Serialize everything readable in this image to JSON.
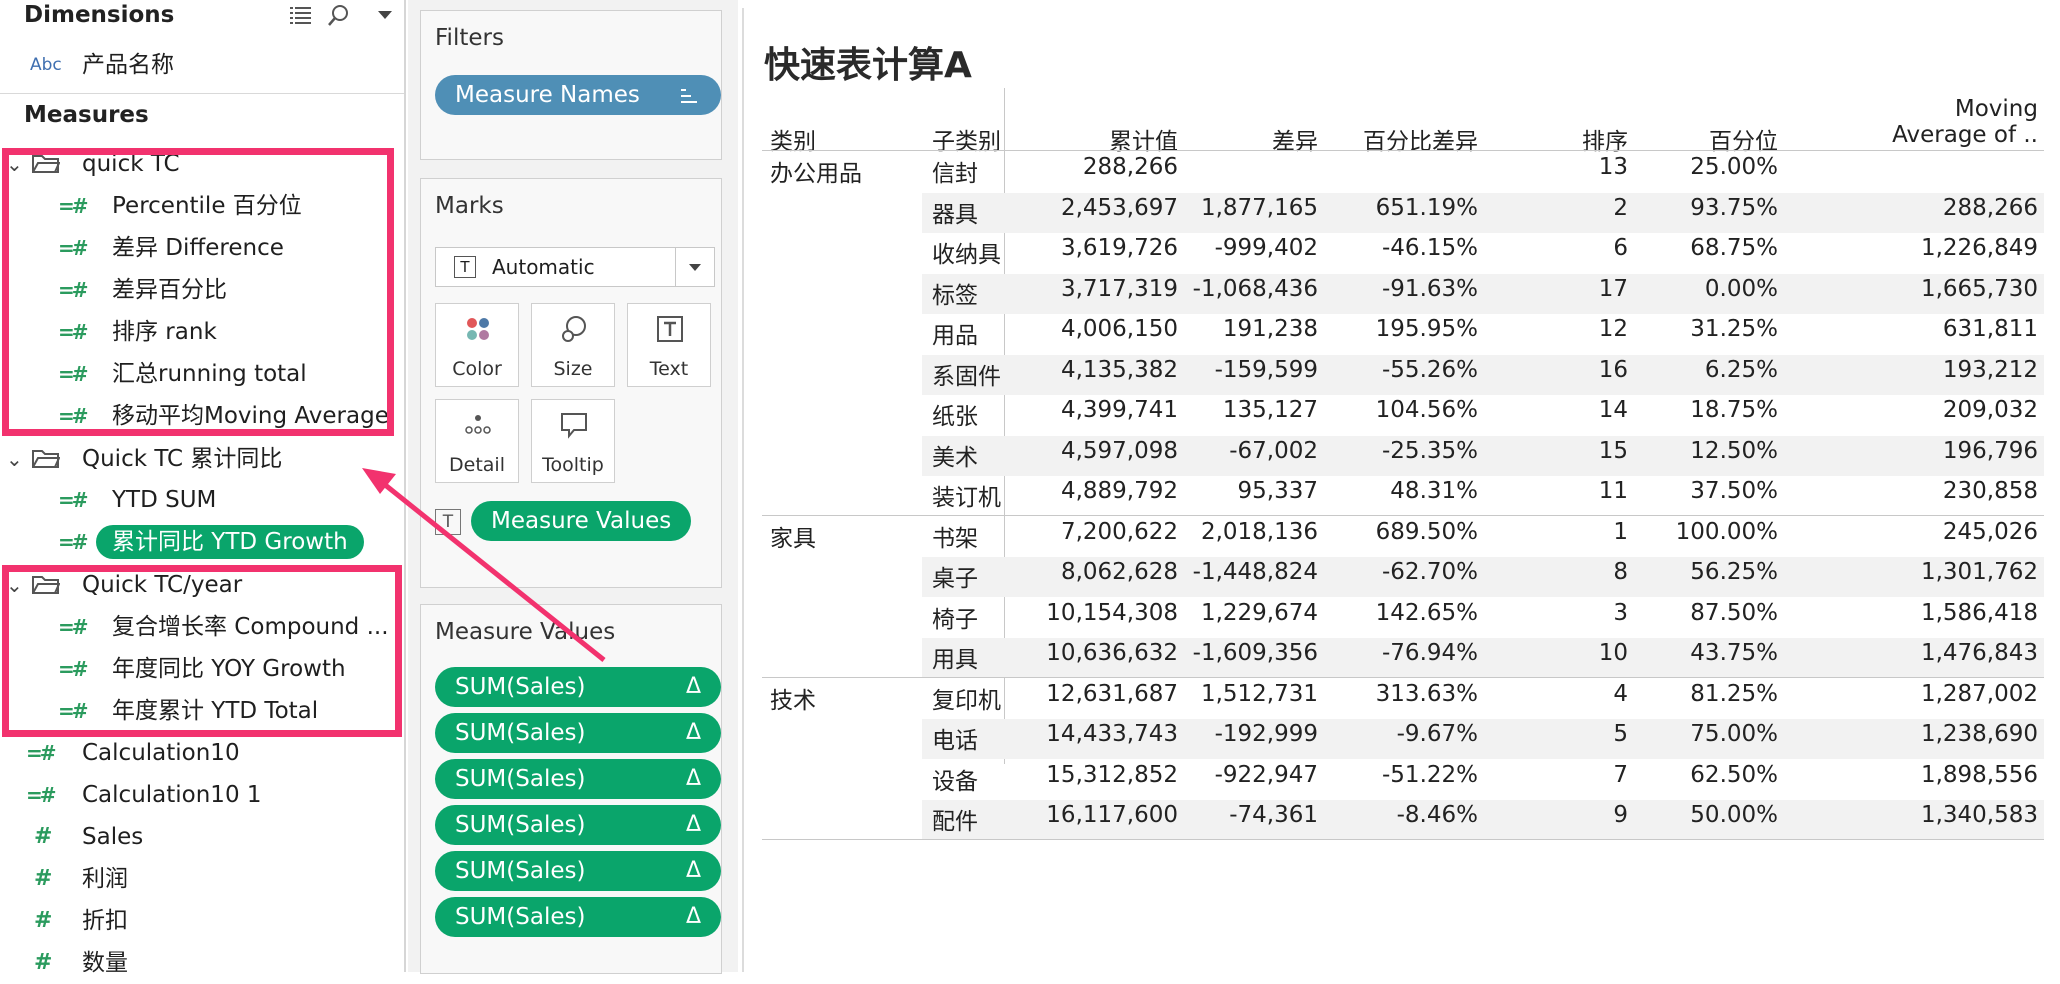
{
  "data_pane": {
    "dimensions_title": "Dimensions",
    "dimension_fields": [
      {
        "type": "Abc",
        "label": "产品名称"
      }
    ],
    "measures_title": "Measures",
    "folders": [
      {
        "name": "quick TC",
        "fields": [
          "Percentile 百分位",
          "差异 Difference",
          "差异百分比",
          "排序 rank",
          "汇总running total",
          "移动平均Moving Average"
        ]
      },
      {
        "name": "Quick TC 累计同比",
        "fields": [
          "YTD SUM",
          "累计同比 YTD Growth"
        ]
      },
      {
        "name": "Quick TC/year",
        "fields": [
          "复合增长率 Compound ...",
          "年度同比 YOY Growth",
          "年度累计 YTD Total"
        ]
      }
    ],
    "loose_measures": [
      "Calculation10",
      "Calculation10 1",
      "Sales",
      "利润",
      "折扣",
      "数量"
    ]
  },
  "shelves": {
    "filters_title": "Filters",
    "filter_pill": "Measure Names",
    "marks_title": "Marks",
    "mark_type": "Automatic",
    "mark_buttons": [
      "Color",
      "Size",
      "Text",
      "Detail",
      "Tooltip"
    ],
    "text_pill": "Measure Values",
    "measure_values_title": "Measure Values",
    "measure_values_pills": [
      "SUM(Sales)",
      "SUM(Sales)",
      "SUM(Sales)",
      "SUM(Sales)",
      "SUM(Sales)",
      "SUM(Sales)"
    ],
    "delta_symbol": "Δ"
  },
  "view": {
    "title": "快速表计算A",
    "headers": [
      "类别",
      "子类别",
      "累计值",
      "差异",
      "百分比差异",
      "排序",
      "百分位",
      "Moving",
      "Average of .."
    ],
    "groups": [
      {
        "category": "办公用品",
        "rows": [
          [
            "信封",
            "288,266",
            "",
            "",
            "13",
            "25.00%",
            ""
          ],
          [
            "器具",
            "2,453,697",
            "1,877,165",
            "651.19%",
            "2",
            "93.75%",
            "288,266"
          ],
          [
            "收纳具",
            "3,619,726",
            "-999,402",
            "-46.15%",
            "6",
            "68.75%",
            "1,226,849"
          ],
          [
            "标签",
            "3,717,319",
            "-1,068,436",
            "-91.63%",
            "17",
            "0.00%",
            "1,665,730"
          ],
          [
            "用品",
            "4,006,150",
            "191,238",
            "195.95%",
            "12",
            "31.25%",
            "631,811"
          ],
          [
            "系固件",
            "4,135,382",
            "-159,599",
            "-55.26%",
            "16",
            "6.25%",
            "193,212"
          ],
          [
            "纸张",
            "4,399,741",
            "135,127",
            "104.56%",
            "14",
            "18.75%",
            "209,032"
          ],
          [
            "美术",
            "4,597,098",
            "-67,002",
            "-25.35%",
            "15",
            "12.50%",
            "196,796"
          ],
          [
            "装订机",
            "4,889,792",
            "95,337",
            "48.31%",
            "11",
            "37.50%",
            "230,858"
          ]
        ]
      },
      {
        "category": "家具",
        "rows": [
          [
            "书架",
            "7,200,622",
            "2,018,136",
            "689.50%",
            "1",
            "100.00%",
            "245,026"
          ],
          [
            "桌子",
            "8,062,628",
            "-1,448,824",
            "-62.70%",
            "8",
            "56.25%",
            "1,301,762"
          ],
          [
            "椅子",
            "10,154,308",
            "1,229,674",
            "142.65%",
            "3",
            "87.50%",
            "1,586,418"
          ],
          [
            "用具",
            "10,636,632",
            "-1,609,356",
            "-76.94%",
            "10",
            "43.75%",
            "1,476,843"
          ]
        ]
      },
      {
        "category": "技术",
        "rows": [
          [
            "复印机",
            "12,631,687",
            "1,512,731",
            "313.63%",
            "4",
            "81.25%",
            "1,287,002"
          ],
          [
            "电话",
            "14,433,743",
            "-192,999",
            "-9.67%",
            "5",
            "75.00%",
            "1,238,690"
          ],
          [
            "设备",
            "15,312,852",
            "-922,947",
            "-51.22%",
            "7",
            "62.50%",
            "1,898,556"
          ],
          [
            "配件",
            "16,117,600",
            "-74,361",
            "-8.46%",
            "9",
            "50.00%",
            "1,340,583"
          ]
        ]
      }
    ]
  },
  "colors": {
    "highlight": "#f2326e",
    "green_pill": "#0aa56b",
    "blue_pill": "#4f8fb6",
    "measure_icon": "#2b9b5e"
  }
}
